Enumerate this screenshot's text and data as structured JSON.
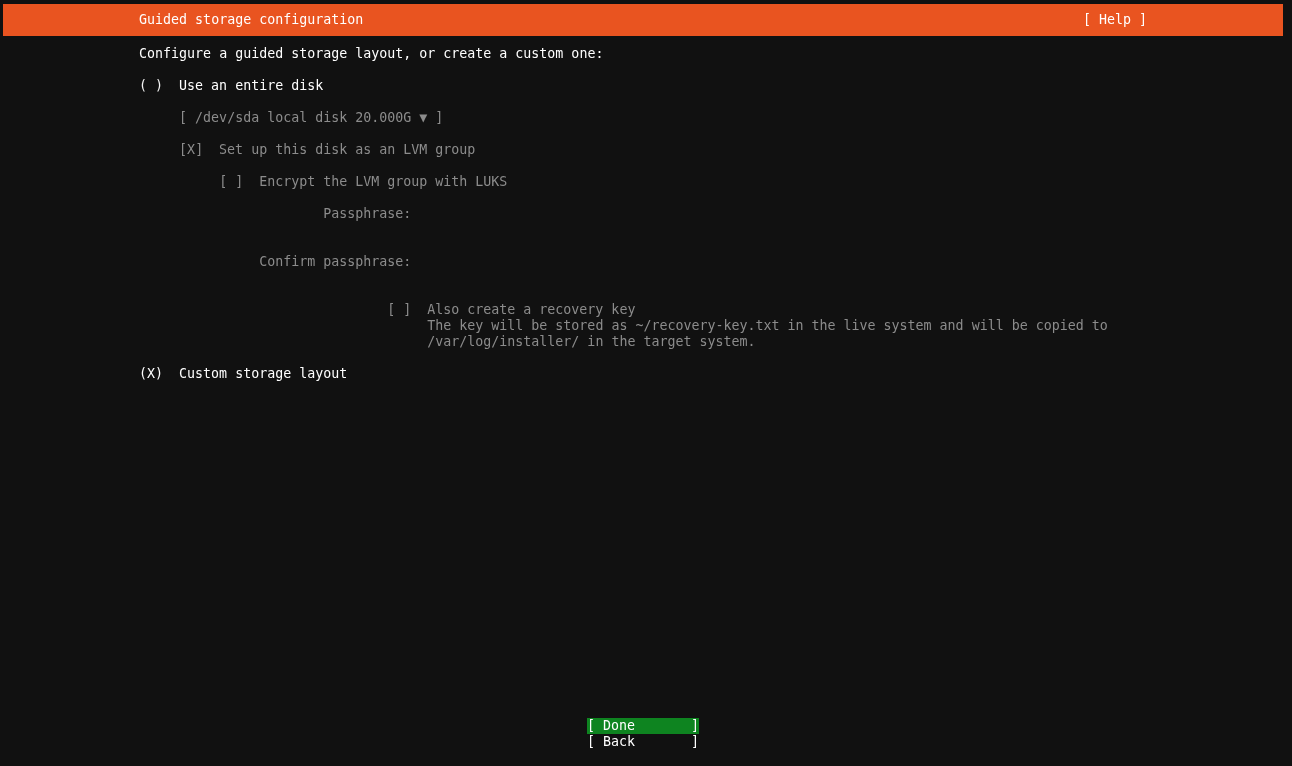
{
  "header": {
    "title": "Guided storage configuration",
    "help": "[ Help ]"
  },
  "intro": "Configure a guided storage layout, or create a custom one:",
  "options": [
    {
      "brackets": [
        "(",
        ")"
      ],
      "selected": false,
      "label": "Use an entire disk",
      "disk": {
        "value": "[ /dev/sda local disk 20.000G ▼ ]",
        "disabled": true
      },
      "lvm": {
        "brackets": [
          "[",
          "]"
        ],
        "checked": true,
        "marker": "X",
        "label": "Set up this disk as an LVM group",
        "disabled": true
      },
      "encrypt": {
        "brackets": [
          "[",
          "]"
        ],
        "checked": false,
        "label": "Encrypt the LVM group with LUKS",
        "disabled": true
      },
      "fields": [
        {
          "label": "Passphrase:",
          "disabled": true
        },
        {
          "label": "Confirm passphrase:",
          "disabled": true
        }
      ],
      "recovery": {
        "brackets": [
          "[",
          "]"
        ],
        "checked": false,
        "label": "Also create a recovery key",
        "disabled": true,
        "description": [
          "The key will be stored as ~/recovery-key.txt in the live system and will be copied to",
          "/var/log/installer/ in the target system."
        ]
      }
    },
    {
      "brackets": [
        "(",
        ")"
      ],
      "selected": true,
      "marker": "X",
      "label": "Custom storage layout"
    }
  ],
  "buttons": [
    {
      "label": "[ Done       ]",
      "selected": true
    },
    {
      "label": "[ Back       ]",
      "selected": false
    }
  ]
}
